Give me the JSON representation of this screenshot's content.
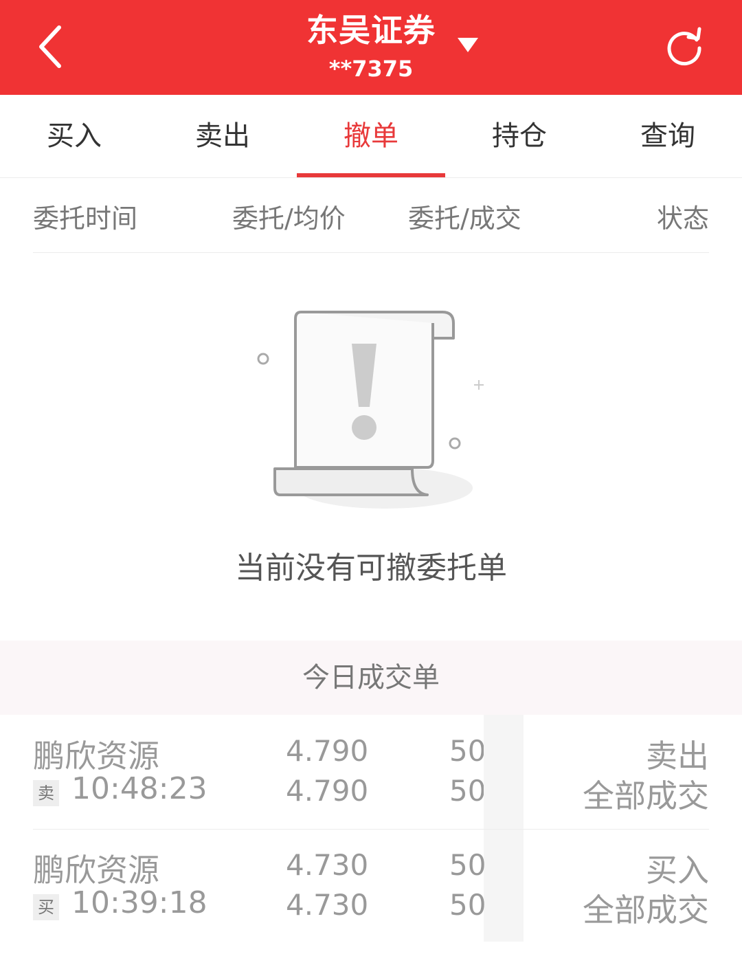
{
  "header": {
    "title": "东吴证券",
    "account": "**7375",
    "back_icon": "chevron-left-icon",
    "dropdown_icon": "triangle-down-icon",
    "refresh_icon": "refresh-icon",
    "bg_color": "#f03334"
  },
  "tabs": [
    {
      "label": "买入"
    },
    {
      "label": "卖出"
    },
    {
      "label": "撤单",
      "active": true
    },
    {
      "label": "持仓"
    },
    {
      "label": "查询"
    }
  ],
  "columns": {
    "time": "委托时间",
    "price": "委托/均价",
    "qty": "委托/成交",
    "status": "状态"
  },
  "empty": {
    "icon": "empty-document-exclamation-icon",
    "text": "当前没有可撤委托单"
  },
  "today_section": {
    "title": "今日成交单"
  },
  "trades": [
    {
      "name": "鹏欣资源",
      "tag": "卖",
      "time": "10:48:23",
      "order_price": "4.790",
      "avg_price": "4.790",
      "order_qty": "50",
      "filled_qty": "50",
      "side": "卖出",
      "status": "全部成交"
    },
    {
      "name": "鹏欣资源",
      "tag": "买",
      "time": "10:39:18",
      "order_price": "4.730",
      "avg_price": "4.730",
      "order_qty": "50",
      "filled_qty": "50",
      "side": "买入",
      "status": "全部成交"
    }
  ]
}
